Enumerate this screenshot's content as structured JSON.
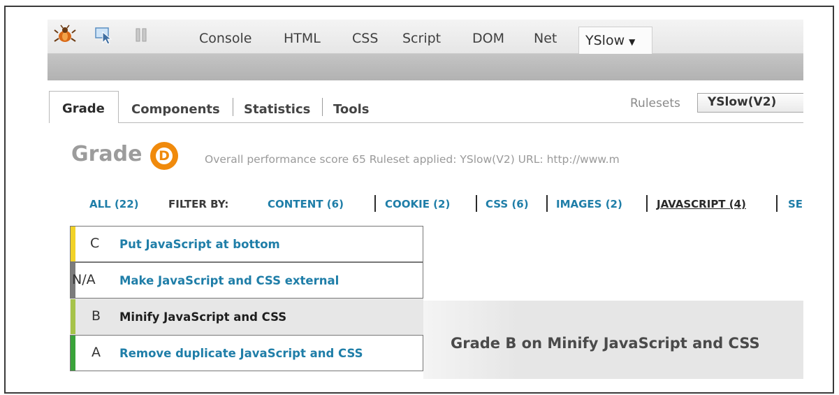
{
  "firebug": {
    "tabs": [
      "Console",
      "HTML",
      "CSS",
      "Script",
      "DOM",
      "Net"
    ],
    "active_tab": "YSlow",
    "colors": {
      "toolbar": "#e9e9e9",
      "subbar": "#b9b9b9"
    }
  },
  "yslow": {
    "sub_tabs": [
      "Grade",
      "Components",
      "Statistics",
      "Tools"
    ],
    "rulesets_label": "Rulesets",
    "rulesets_value": "YSlow(V2)"
  },
  "grade": {
    "label": "Grade",
    "letter": "D",
    "summary": "Overall performance score 65   Ruleset applied: YSlow(V2)   URL: http://www.m",
    "accent": "#f08a0c"
  },
  "filter": {
    "all": "ALL (22)",
    "by": "FILTER BY:",
    "items": [
      "CONTENT (6)",
      "COOKIE (2)",
      "CSS (6)",
      "IMAGES (2)",
      "JAVASCRIPT (4)",
      "SE"
    ],
    "active": "JAVASCRIPT (4)"
  },
  "rules": [
    {
      "grade": "C",
      "title": "Put JavaScript at bottom",
      "color": "#f2d227"
    },
    {
      "grade": "N/A",
      "title": "Make JavaScript and CSS external",
      "color": "#7c7c7c"
    },
    {
      "grade": "B",
      "title": "Minify JavaScript and CSS",
      "color": "#a6c34a",
      "selected": true
    },
    {
      "grade": "A",
      "title": "Remove duplicate JavaScript and CSS",
      "color": "#3aa33a"
    }
  ],
  "detail": {
    "title": "Grade B on Minify JavaScript and CSS"
  }
}
